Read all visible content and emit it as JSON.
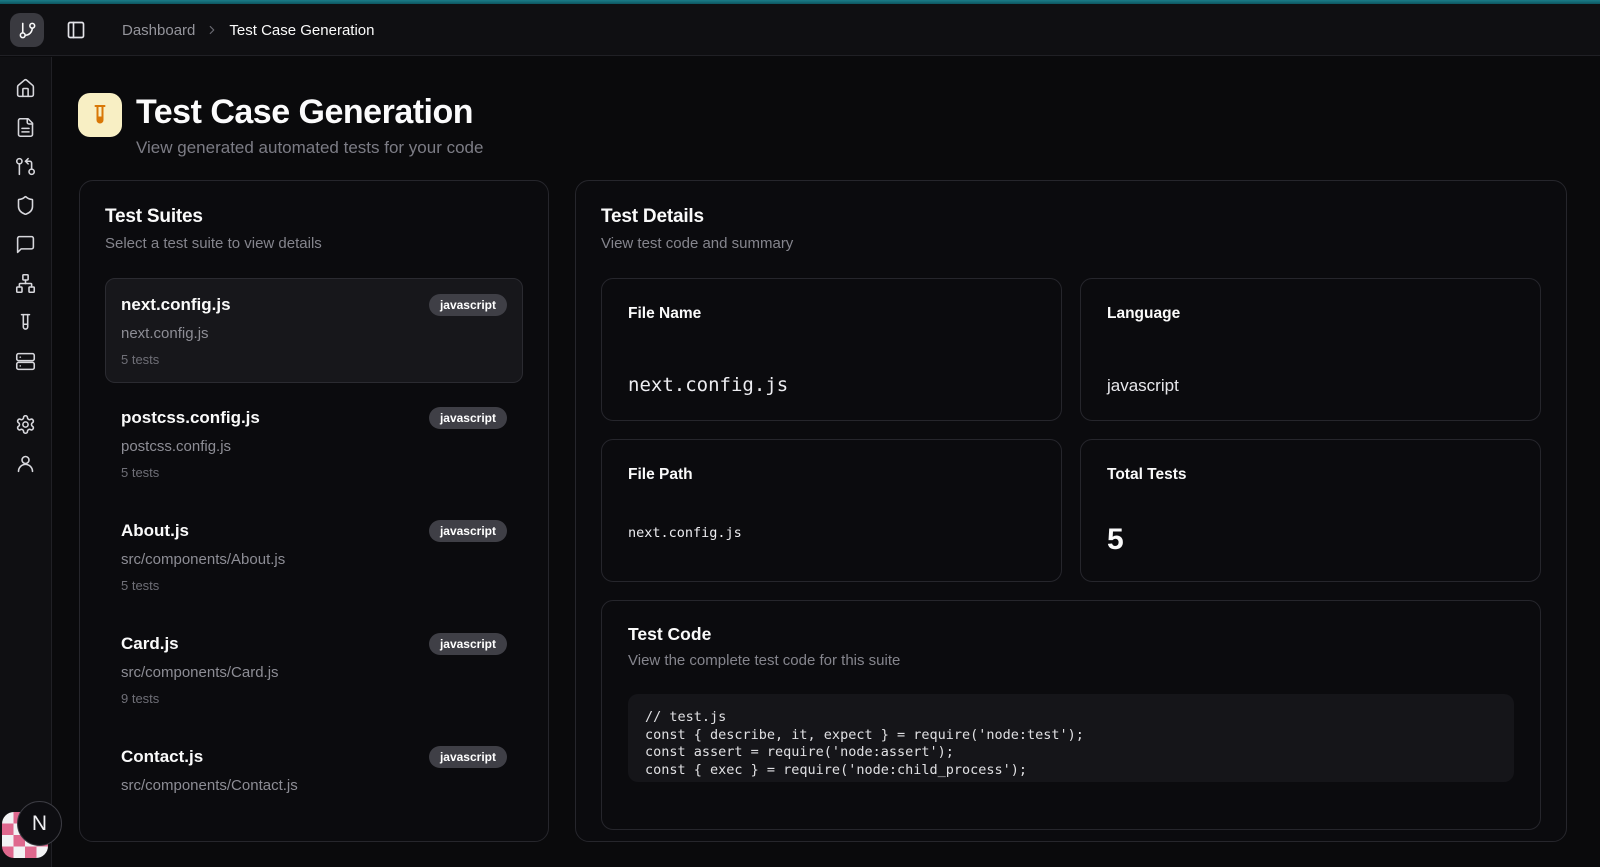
{
  "accent": {
    "top_bar_color": "#0e5f6a"
  },
  "header": {
    "logo_icon": "git-branch-icon",
    "breadcrumb": {
      "parent": "Dashboard",
      "current": "Test Case Generation"
    }
  },
  "sidebar": {
    "icons": [
      "home-icon",
      "file-text-icon",
      "git-pull-request-icon",
      "shield-icon",
      "message-square-icon",
      "network-icon",
      "test-tube-icon",
      "server-icon",
      "settings-icon",
      "user-icon"
    ]
  },
  "page": {
    "icon": "test-tube-icon",
    "icon_bg": "#f8efc4",
    "icon_color": "#d97706",
    "title": "Test Case Generation",
    "subtitle": "View generated automated tests for your code"
  },
  "suites_panel": {
    "title": "Test Suites",
    "subtitle": "Select a test suite to view details",
    "items": [
      {
        "name": "next.config.js",
        "language": "javascript",
        "path": "next.config.js",
        "tests": "5 tests",
        "selected": true
      },
      {
        "name": "postcss.config.js",
        "language": "javascript",
        "path": "postcss.config.js",
        "tests": "5 tests",
        "selected": false
      },
      {
        "name": "About.js",
        "language": "javascript",
        "path": "src/components/About.js",
        "tests": "5 tests",
        "selected": false
      },
      {
        "name": "Card.js",
        "language": "javascript",
        "path": "src/components/Card.js",
        "tests": "9 tests",
        "selected": false
      },
      {
        "name": "Contact.js",
        "language": "javascript",
        "path": "src/components/Contact.js",
        "tests": "",
        "selected": false
      }
    ]
  },
  "details_panel": {
    "title": "Test Details",
    "subtitle": "View test code and summary",
    "cards": [
      {
        "label": "File Name",
        "value": "next.config.js"
      },
      {
        "label": "Language",
        "value": "javascript"
      },
      {
        "label": "File Path",
        "value": "next.config.js"
      },
      {
        "label": "Total Tests",
        "value": "5"
      }
    ],
    "code_section": {
      "title": "Test Code",
      "subtitle": "View the complete test code for this suite",
      "code": "// test.js\nconst { describe, it, expect } = require('node:test');\nconst assert = require('node:assert');\nconst { exec } = require('node:child_process');"
    }
  },
  "floating": {
    "next_badge_letter": "N"
  }
}
